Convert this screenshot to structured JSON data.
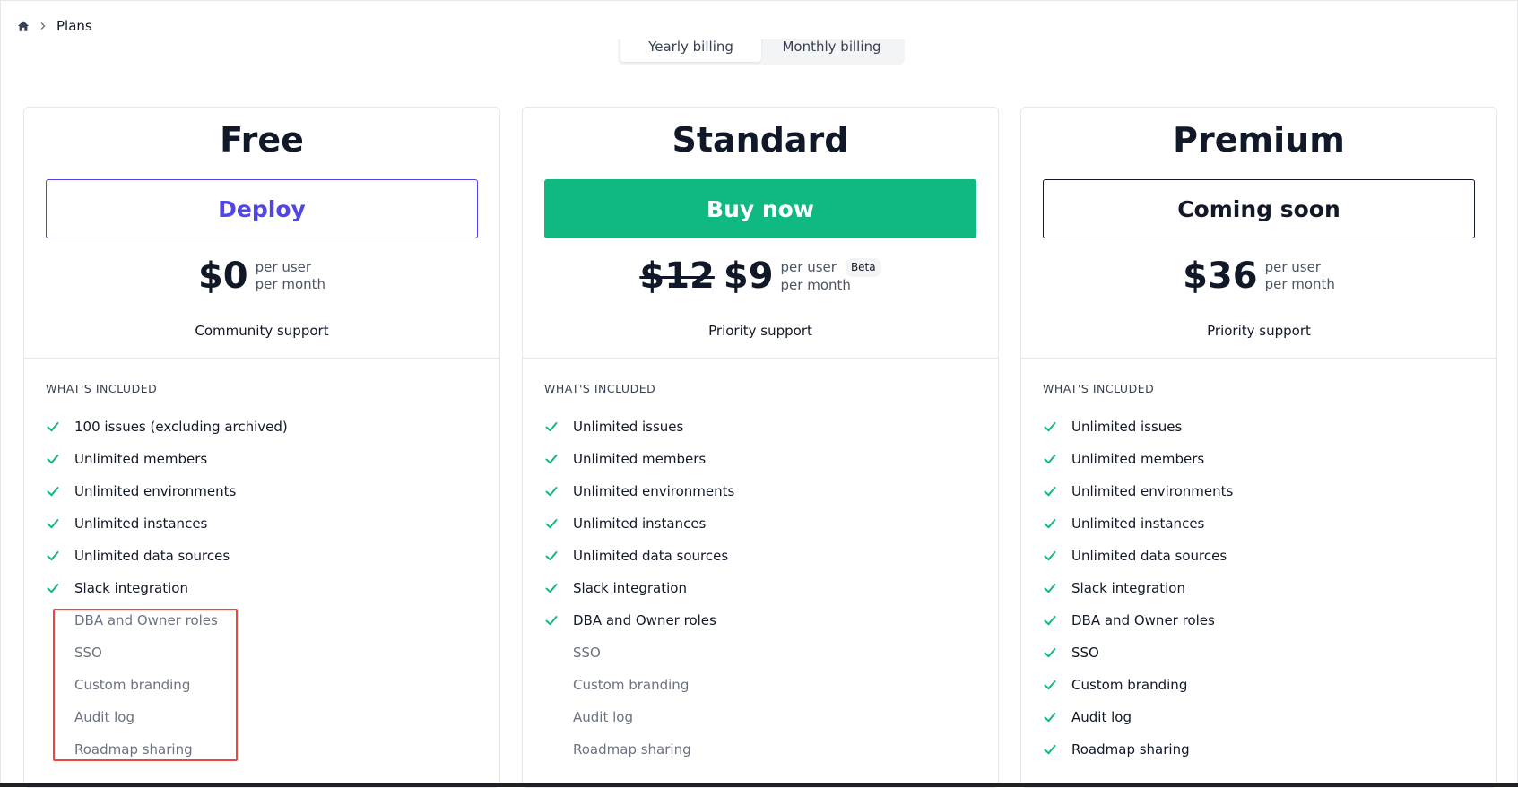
{
  "breadcrumb": {
    "current": "Plans"
  },
  "billing": {
    "yearly": "Yearly billing",
    "monthly": "Monthly billing"
  },
  "section_label": "WHAT'S INCLUDED",
  "colors": {
    "accent": "#4f46e5",
    "success": "#10b981",
    "highlight": "#ef4444"
  },
  "plans": [
    {
      "name": "Free",
      "cta": "Deploy",
      "price": "$0",
      "per_user": "per user",
      "per_month": "per month",
      "support": "Community support",
      "features": [
        {
          "label": "100 issues (excluding archived)",
          "included": true
        },
        {
          "label": "Unlimited members",
          "included": true
        },
        {
          "label": "Unlimited environments",
          "included": true
        },
        {
          "label": "Unlimited instances",
          "included": true
        },
        {
          "label": "Unlimited data sources",
          "included": true
        },
        {
          "label": "Slack integration",
          "included": true
        },
        {
          "label": "DBA and Owner roles",
          "included": false
        },
        {
          "label": "SSO",
          "included": false
        },
        {
          "label": "Custom branding",
          "included": false
        },
        {
          "label": "Audit log",
          "included": false
        },
        {
          "label": "Roadmap sharing",
          "included": false
        }
      ]
    },
    {
      "name": "Standard",
      "cta": "Buy now",
      "old_price": "$12",
      "price": "$9",
      "per_user": "per user",
      "per_month": "per month",
      "badge": "Beta",
      "support": "Priority support",
      "features": [
        {
          "label": "Unlimited issues",
          "included": true
        },
        {
          "label": "Unlimited members",
          "included": true
        },
        {
          "label": "Unlimited environments",
          "included": true
        },
        {
          "label": "Unlimited instances",
          "included": true
        },
        {
          "label": "Unlimited data sources",
          "included": true
        },
        {
          "label": "Slack integration",
          "included": true
        },
        {
          "label": "DBA and Owner roles",
          "included": true
        },
        {
          "label": "SSO",
          "included": false
        },
        {
          "label": "Custom branding",
          "included": false
        },
        {
          "label": "Audit log",
          "included": false
        },
        {
          "label": "Roadmap sharing",
          "included": false
        }
      ]
    },
    {
      "name": "Premium",
      "cta": "Coming soon",
      "price": "$36",
      "per_user": "per user",
      "per_month": "per month",
      "support": "Priority support",
      "features": [
        {
          "label": "Unlimited issues",
          "included": true
        },
        {
          "label": "Unlimited members",
          "included": true
        },
        {
          "label": "Unlimited environments",
          "included": true
        },
        {
          "label": "Unlimited instances",
          "included": true
        },
        {
          "label": "Unlimited data sources",
          "included": true
        },
        {
          "label": "Slack integration",
          "included": true
        },
        {
          "label": "DBA and Owner roles",
          "included": true
        },
        {
          "label": "SSO",
          "included": true
        },
        {
          "label": "Custom branding",
          "included": true
        },
        {
          "label": "Audit log",
          "included": true
        },
        {
          "label": "Roadmap sharing",
          "included": true
        }
      ]
    }
  ]
}
